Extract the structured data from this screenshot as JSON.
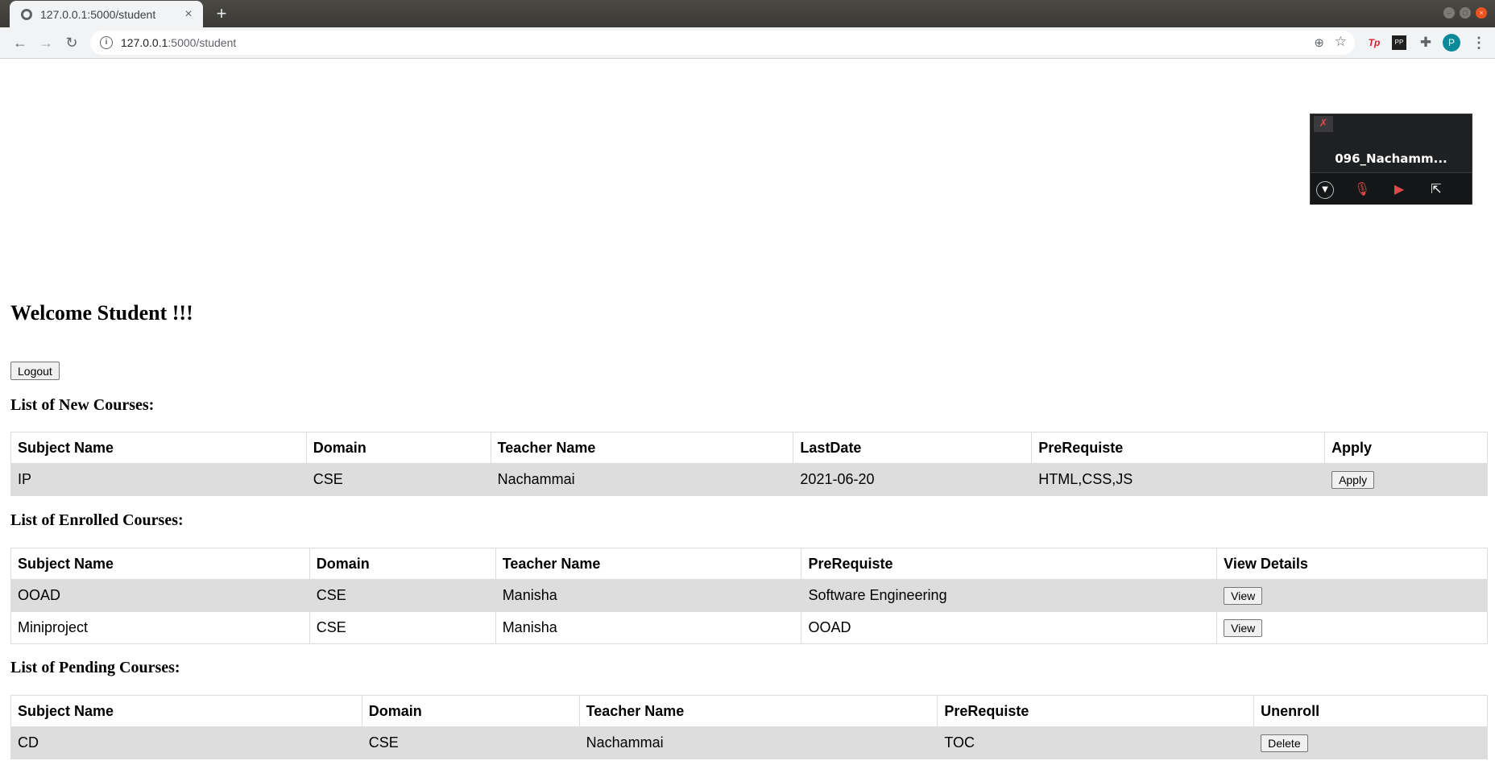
{
  "browser": {
    "tab_title": "127.0.0.1:5000/student",
    "tab_close": "×",
    "new_tab": "+",
    "url_host": "127.0.0.1",
    "url_path": ":5000/student",
    "profile_initial": "P",
    "ext_tp": "Tp",
    "ext_pp": "PP"
  },
  "meeting": {
    "participant": "096_Nachamm..."
  },
  "page": {
    "heading": "Welcome Student !!!",
    "logout_label": "Logout"
  },
  "new_courses": {
    "title": "List of New Courses:",
    "headers": [
      "Subject Name",
      "Domain",
      "Teacher Name",
      "LastDate",
      "PreRequiste",
      "Apply"
    ],
    "rows": [
      {
        "subject": "IP",
        "domain": "CSE",
        "teacher": "Nachammai",
        "lastdate": "2021-06-20",
        "prereq": "HTML,CSS,JS",
        "action": "Apply"
      }
    ]
  },
  "enrolled_courses": {
    "title": "List of Enrolled Courses:",
    "headers": [
      "Subject Name",
      "Domain",
      "Teacher Name",
      "PreRequiste",
      "View Details"
    ],
    "rows": [
      {
        "subject": "OOAD",
        "domain": "CSE",
        "teacher": "Manisha",
        "prereq": "Software Engineering",
        "action": "View"
      },
      {
        "subject": "Miniproject",
        "domain": "CSE",
        "teacher": "Manisha",
        "prereq": "OOAD",
        "action": "View"
      }
    ]
  },
  "pending_courses": {
    "title": "List of Pending Courses:",
    "headers": [
      "Subject Name",
      "Domain",
      "Teacher Name",
      "PreRequiste",
      "Unenroll"
    ],
    "rows": [
      {
        "subject": "CD",
        "domain": "CSE",
        "teacher": "Nachammai",
        "prereq": "TOC",
        "action": "Delete"
      }
    ]
  }
}
